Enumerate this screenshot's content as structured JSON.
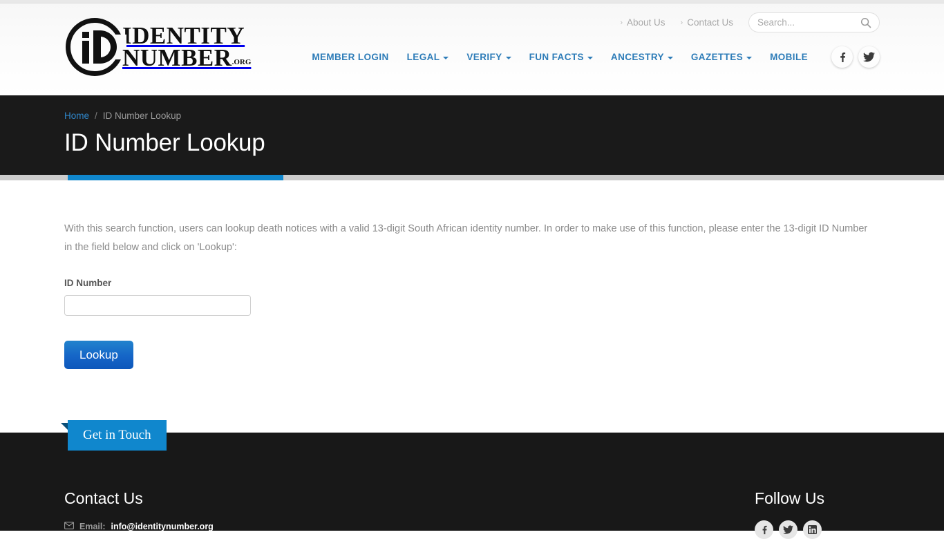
{
  "brand": {
    "logo_line1": "IDENTITY",
    "logo_line2": "NUMBER",
    "logo_suffix": ".ORG",
    "accent_color": "#1087cd",
    "nav_color": "#2d7cb8"
  },
  "utility": {
    "links": [
      {
        "label": "About Us",
        "chevron": "chevron-right-icon"
      },
      {
        "label": "Contact Us",
        "chevron": "chevron-right-icon"
      }
    ],
    "search": {
      "placeholder": "Search...",
      "value": "",
      "icon": "search-icon"
    }
  },
  "nav": {
    "items": [
      {
        "label": "MEMBER LOGIN",
        "has_caret": false
      },
      {
        "label": "LEGAL",
        "has_caret": true
      },
      {
        "label": "VERIFY",
        "has_caret": true
      },
      {
        "label": "FUN FACTS",
        "has_caret": true
      },
      {
        "label": "ANCESTRY",
        "has_caret": true
      },
      {
        "label": "GAZETTES",
        "has_caret": true
      },
      {
        "label": "MOBILE",
        "has_caret": false
      }
    ],
    "social": [
      {
        "name": "facebook-icon"
      },
      {
        "name": "twitter-icon"
      }
    ]
  },
  "banner": {
    "breadcrumb_home": "Home",
    "breadcrumb_separator": "/",
    "breadcrumb_current": "ID Number Lookup",
    "title": "ID Number Lookup"
  },
  "main": {
    "intro": "With this search function, users can lookup death notices with a valid 13-digit South African identity number. In order to make use of this function, please enter the 13-digit ID Number in the field below and click on 'Lookup':",
    "form": {
      "label": "ID Number",
      "input_value": "",
      "input_placeholder": "",
      "submit_label": "Lookup"
    }
  },
  "ribbon": {
    "label": "Get in Touch"
  },
  "footer": {
    "contact_heading": "Contact Us",
    "email_label": "Email:",
    "email_value": "info@identitynumber.org",
    "email_icon": "envelope-icon",
    "follow_heading": "Follow Us",
    "social": [
      {
        "name": "facebook-icon"
      },
      {
        "name": "twitter-icon"
      },
      {
        "name": "linkedin-icon"
      }
    ]
  }
}
